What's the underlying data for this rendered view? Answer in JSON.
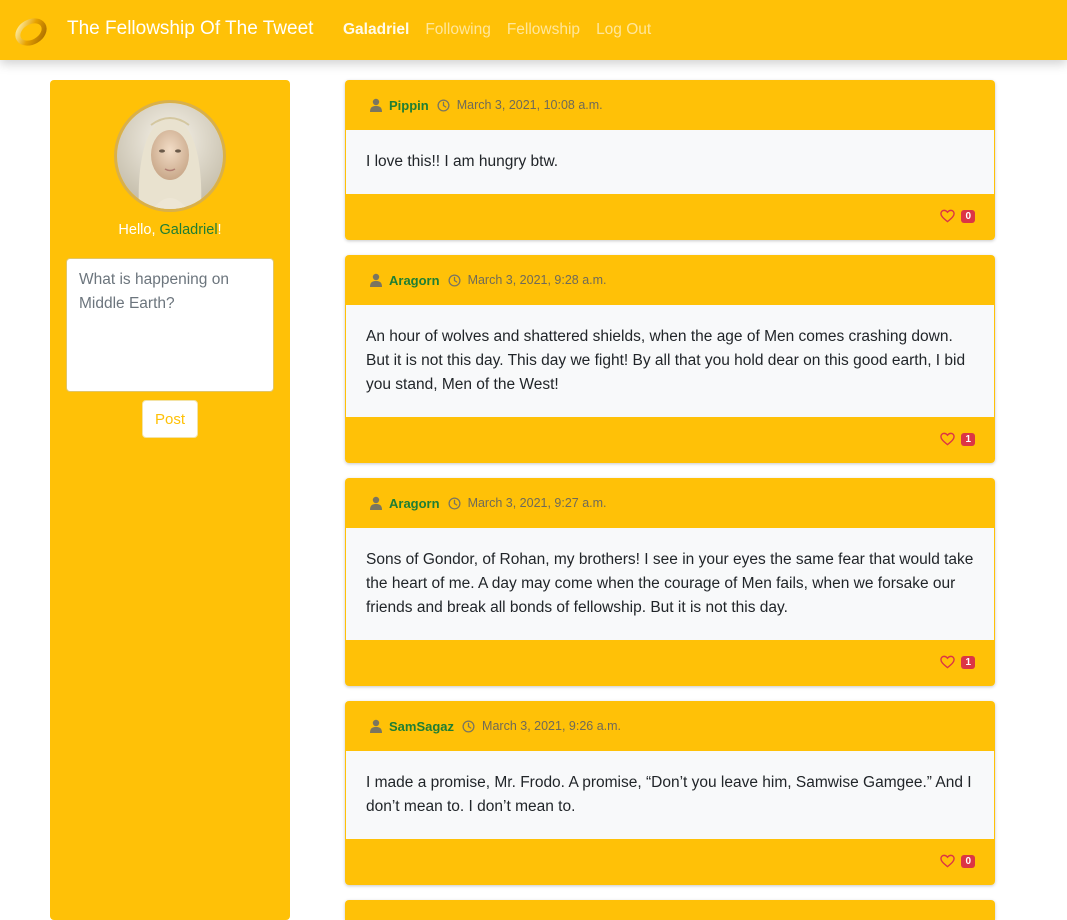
{
  "nav": {
    "brand": "The Fellowship Of The Tweet",
    "links": [
      "Galadriel",
      "Following",
      "Fellowship",
      "Log Out"
    ]
  },
  "sidebar": {
    "hello_prefix": "Hello, ",
    "username": "Galadriel",
    "hello_suffix": "!",
    "placeholder": "What is happening on Middle Earth?",
    "post_label": "Post"
  },
  "tweets": [
    {
      "user": "Pippin",
      "time": "March 3, 2021, 10:08 a.m.",
      "text": "I love this!! I am hungry btw.",
      "likes": "0"
    },
    {
      "user": "Aragorn",
      "time": "March 3, 2021, 9:28 a.m.",
      "text": "An hour of wolves and shattered shields, when the age of Men comes crashing down. But it is not this day. This day we fight! By all that you hold dear on this good earth, I bid you stand, Men of the West!",
      "likes": "1"
    },
    {
      "user": "Aragorn",
      "time": "March 3, 2021, 9:27 a.m.",
      "text": "Sons of Gondor, of Rohan, my brothers! I see in your eyes the same fear that would take the heart of me. A day may come when the courage of Men fails, when we forsake our friends and break all bonds of fellowship. But it is not this day.",
      "likes": "1"
    },
    {
      "user": "SamSagaz",
      "time": "March 3, 2021, 9:26 a.m.",
      "text": "I made a promise, Mr. Frodo. A promise, “Don’t you leave him, Samwise Gamgee.” And I don’t mean to. I don’t mean to.",
      "likes": "0"
    }
  ],
  "colors": {
    "primary": "#ffc107",
    "username": "#1e7e34",
    "badge": "#dc3545",
    "body_bg": "#f8f9fa"
  },
  "icons": [
    "ring-logo-icon",
    "user-icon",
    "clock-icon",
    "heart-icon"
  ]
}
